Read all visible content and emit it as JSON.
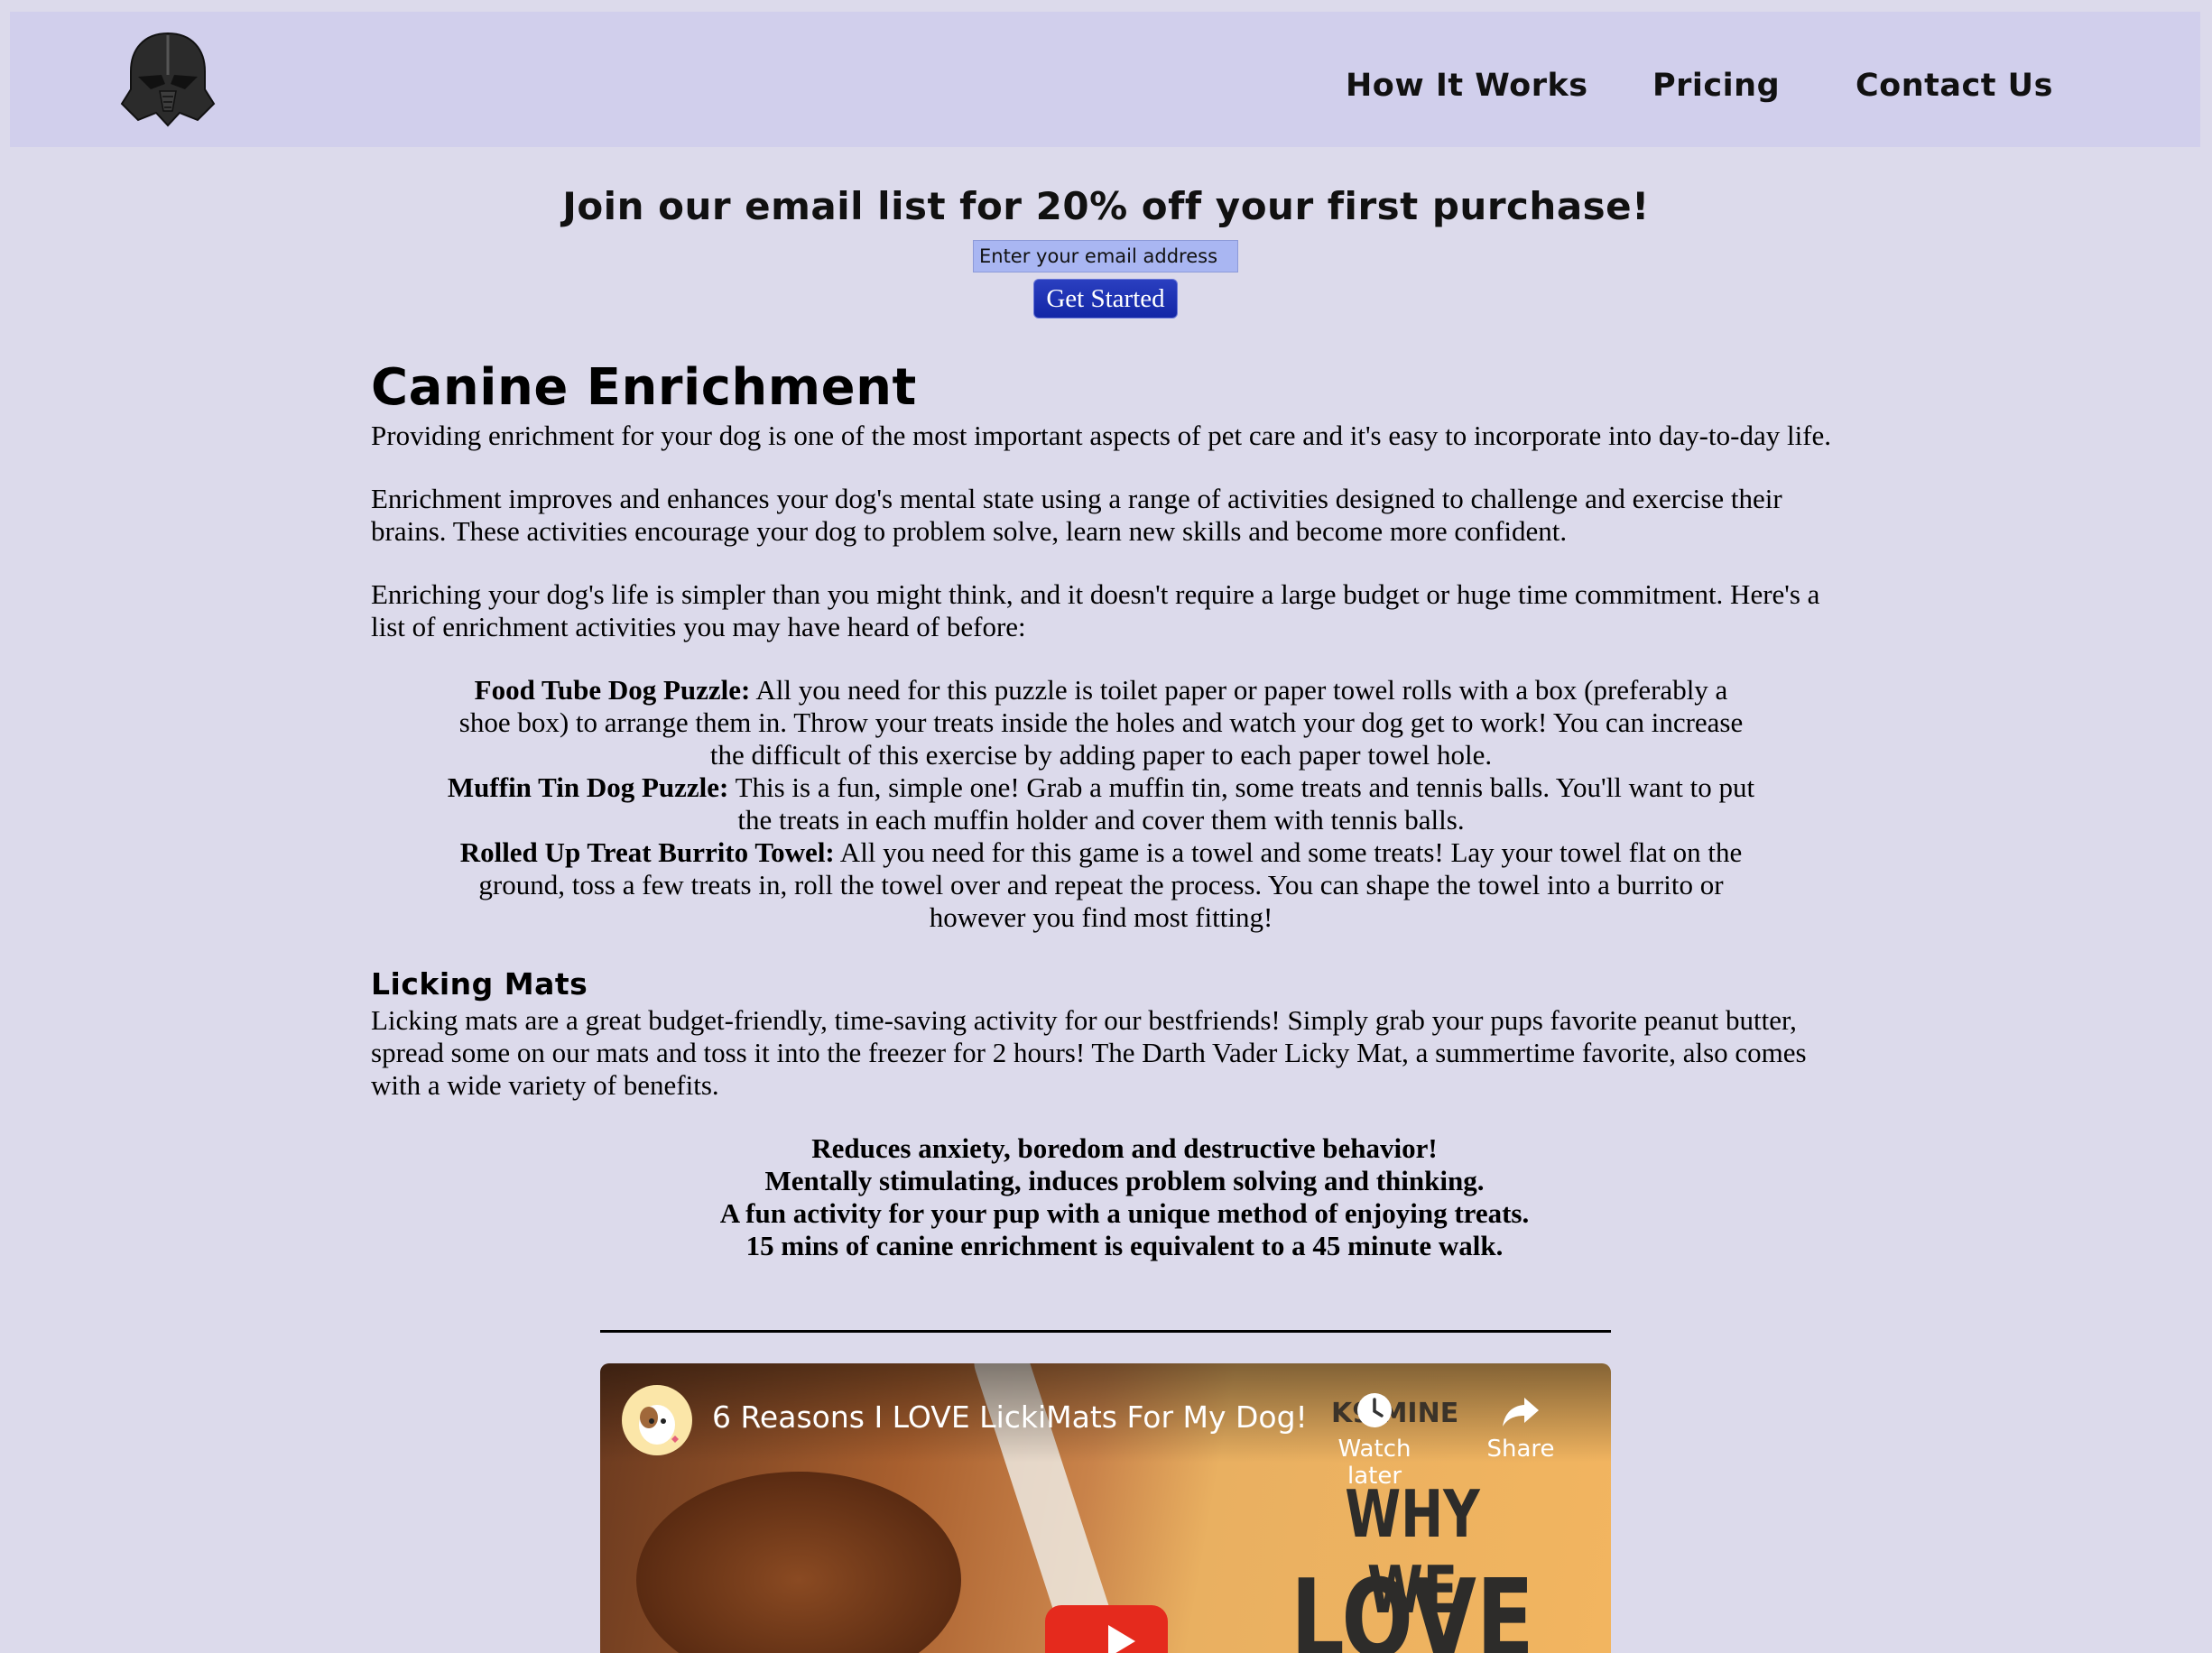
{
  "header": {
    "logo": {
      "icon": "darth-vader-helmet-icon"
    },
    "nav": [
      "How It Works",
      "Pricing",
      "Contact Us"
    ]
  },
  "signup": {
    "title": "Join our email list for 20% off your first purchase!",
    "email_placeholder": "Enter your email address",
    "email_value": "",
    "button": "Get Started"
  },
  "main": {
    "title": "Canine Enrichment",
    "paragraphs": [
      "Providing enrichment for your dog is one of the most important aspects of pet care and it's easy to incorporate into day-to-day life.",
      "Enrichment improves and enhances your dog's mental state using a range of activities designed to challenge and exercise their brains. These activities encourage your dog to problem solve, learn new skills and become more confident.",
      "Enriching your dog's life is simpler than you might think, and it doesn't require a large budget or huge time commitment. Here's a list of enrichment activities you may have heard of before:"
    ],
    "activities": [
      {
        "name": "Food Tube Dog Puzzle:",
        "text": " All you need for this puzzle is toilet paper or paper towel rolls with a box (preferably a shoe box) to arrange them in. Throw your treats inside the holes and watch your dog get to work! You can increase the difficult of this exercise by adding paper to each paper towel hole."
      },
      {
        "name": "Muffin Tin Dog Puzzle:",
        "text": " This is a fun, simple one! Grab a muffin tin, some treats and tennis balls. You'll want to put the treats in each muffin holder and cover them with tennis balls."
      },
      {
        "name": "Rolled Up Treat Burrito Towel:",
        "text": " All you need for this game is a towel and some treats! Lay your towel flat on the ground, toss a few treats in, roll the towel over and repeat the process. You can shape the towel into a burrito or however you find most fitting!"
      }
    ]
  },
  "licking": {
    "title": "Licking Mats",
    "paragraph": "Licking mats are a great budget-friendly, time-saving activity for our bestfriends! Simply grab your pups favorite peanut butter, spread some on our mats and toss it into the freezer for 2 hours! The Darth Vader Licky Mat, a summertime favorite, also comes with a wide variety of benefits.",
    "benefits": [
      "Reduces anxiety, boredom and destructive behavior!",
      "Mentally stimulating, induces problem solving and thinking.",
      "A fun activity for your pup with a unique method of enjoying treats.",
      "15 mins of canine enrichment is equivalent to a 45 minute walk."
    ]
  },
  "video": {
    "title": "6 Reasons I LOVE LickiMats For My Dog!",
    "watch_later": "Watch later",
    "share": "Share",
    "thumbnail_brand": "K9 MINE",
    "thumbnail_line1": "WHY WE",
    "thumbnail_line2": "LOVE"
  }
}
